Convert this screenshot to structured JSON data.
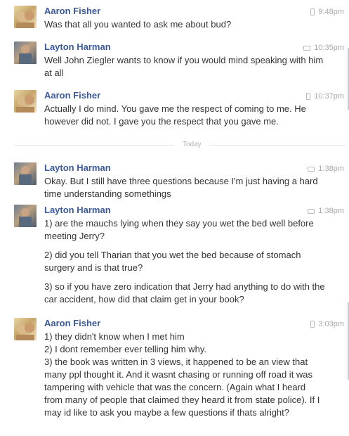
{
  "messages": [
    {
      "sender": "Aaron Fisher",
      "time": "9:48pm",
      "device": "mobile-icon",
      "lines": [
        "Was that all you wanted to ask me about bud?"
      ]
    },
    {
      "sender": "Layton Harman",
      "time": "10:35pm",
      "device": "chat-icon",
      "lines": [
        "Well John Ziegler wants to know if you would mind speaking with him at all"
      ]
    },
    {
      "sender": "Aaron Fisher",
      "time": "10:37pm",
      "device": "mobile-icon",
      "lines": [
        "Actually I do mind. You gave me the respect of coming to me. He however did not. I gave you the respect that you gave me."
      ]
    },
    {
      "sender": "Layton Harman",
      "time": "1:38pm",
      "device": "chat-icon",
      "lines": [
        "Okay. But I still have three questions because I'm just having  a hard time understanding somethings"
      ]
    },
    {
      "sender": "Layton Harman",
      "time": "1:38pm",
      "device": "chat-icon",
      "lines": [
        "1) are the mauchs lying when they say you wet the bed well before meeting Jerry?",
        "2) did you tell Tharian that you wet the bed because of stomach surgery and is that true?",
        "3) so if you have zero indication that Jerry had anything to do with the car accident, how did that claim get in your book?"
      ]
    },
    {
      "sender": "Aaron Fisher",
      "time": "3:03pm",
      "device": "mobile-icon",
      "lines": [
        "1) they didn't know when I met him",
        "2) I dont remember ever telling him why.",
        "3) the book was written in 3 views, it happened to be an view that many ppl thought it. And it wasnt chasing or running off road it was tampering with vehicle that was the concern. (Again what I heard from many of people that claimed they heard it from state police). If I may id like to ask you maybe a few questions if thats alright?"
      ]
    }
  ],
  "divider_label": "Today",
  "colors": {
    "name": "#3b5998",
    "time": "#a7a9ad",
    "text": "#333333",
    "divider": "#e5e6e9"
  }
}
